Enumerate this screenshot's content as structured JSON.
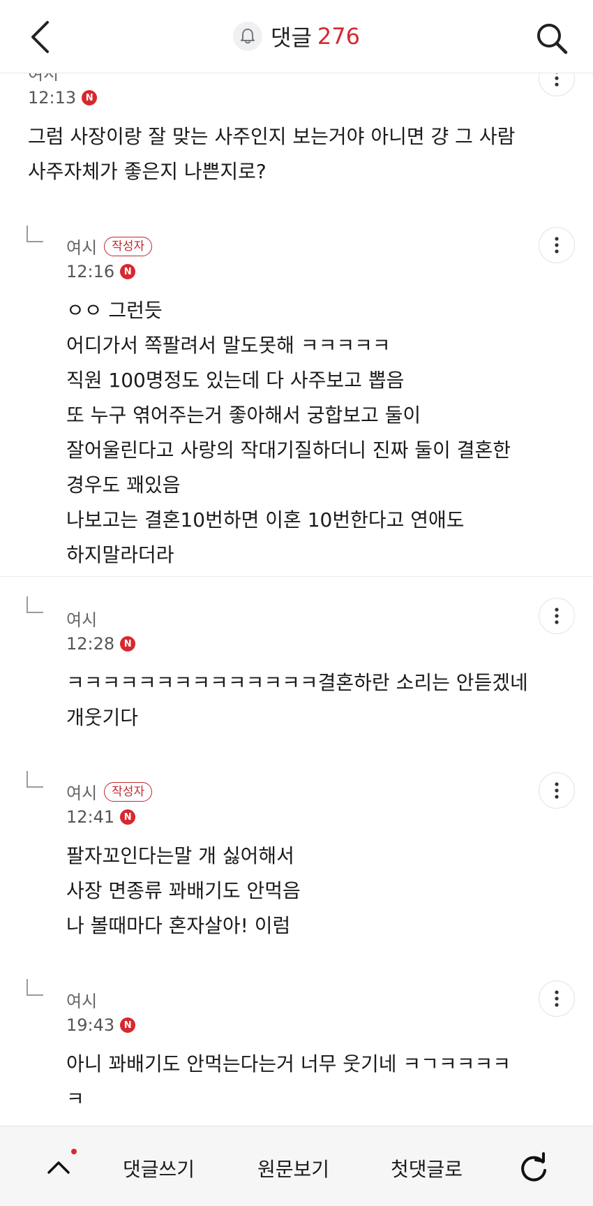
{
  "header": {
    "title": "댓글",
    "count": "276",
    "back_icon": "chevron-left-icon",
    "search_icon": "search-icon",
    "bell_icon": "bell-icon"
  },
  "comments": [
    {
      "author": "여시",
      "time": "12:13",
      "new_badge": "N",
      "body": "그럼 사장이랑 잘 맞는 사주인지 보는거야 아니면 걍 그 사람\n사주자체가 좋은지 나쁜지로?"
    },
    {
      "author": "여시",
      "writer_badge": "작성자",
      "time": "12:16",
      "new_badge": "N",
      "body": "ㅇㅇ 그런듯\n어디가서 쪽팔려서 말도못해 ㅋㅋㅋㅋㅋ\n직원 100명정도 있는데 다 사주보고 뽑음\n또 누구 엮어주는거 좋아해서 궁합보고 둘이\n잘어울린다고 사랑의 작대기질하더니 진짜 둘이 결혼한\n경우도 꽤있음\n나보고는 결혼10번하면 이혼 10번한다고 연애도\n하지말라더라"
    },
    {
      "author": "여시",
      "time": "12:28",
      "new_badge": "N",
      "body": "ㅋㅋㅋㅋㅋㅋㅋㅋㅋㅋㅋㅋㅋㅋ결혼하란 소리는 안듣겠네\n개웃기다"
    },
    {
      "author": "여시",
      "writer_badge": "작성자",
      "time": "12:41",
      "new_badge": "N",
      "body": "팔자꼬인다는말 개 싫어해서\n사장 면종류 꽈배기도 안먹음\n나 볼때마다 혼자살아! 이럼"
    },
    {
      "author": "여시",
      "time": "19:43",
      "new_badge": "N",
      "body": "아니 꽈배기도 안먹는다는거 너무 웃기네 ㅋㄱㅋㅋㅋㅋ\nㅋ"
    }
  ],
  "bottom_bar": {
    "write": "댓글쓰기",
    "original": "원문보기",
    "first": "첫댓글로",
    "up_icon": "chevron-up-icon",
    "refresh_icon": "refresh-icon"
  },
  "colors": {
    "accent": "#d7282f",
    "divider": "#ebebeb"
  }
}
